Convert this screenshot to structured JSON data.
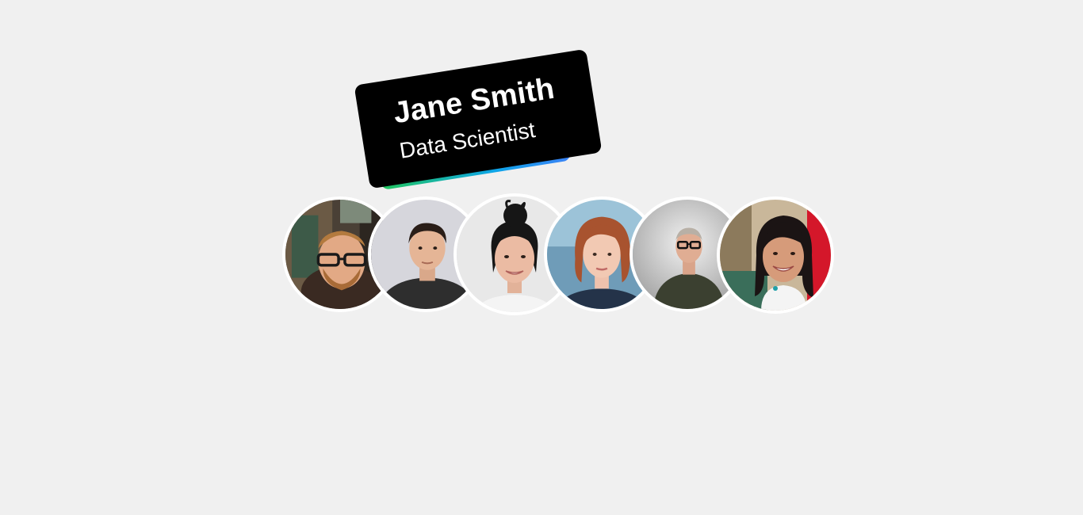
{
  "tooltip": {
    "name": "Jane Smith",
    "role": "Data Scientist"
  },
  "avatars": [
    {
      "icon": "person-avatar-icon",
      "active": false
    },
    {
      "icon": "person-avatar-icon",
      "active": false
    },
    {
      "icon": "person-avatar-icon",
      "active": true
    },
    {
      "icon": "person-avatar-icon",
      "active": false
    },
    {
      "icon": "person-avatar-icon",
      "active": false
    },
    {
      "icon": "person-avatar-icon",
      "active": false
    }
  ],
  "colors": {
    "page_background": "#f0f0f0",
    "tooltip_background": "#000000",
    "tooltip_text": "#ffffff",
    "avatar_border": "#ffffff",
    "accent_start": "#22c55e",
    "accent_end": "#3b82f6"
  }
}
